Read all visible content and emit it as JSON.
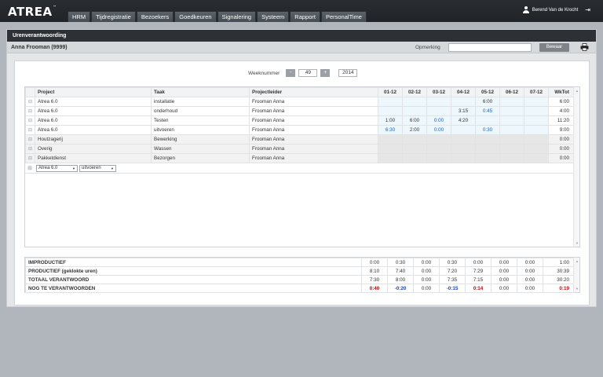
{
  "app": {
    "logo": "ATREA",
    "logo_tm": "™"
  },
  "nav": [
    "HRM",
    "Tijdregistratie",
    "Bezoekers",
    "Goedkeuren",
    "Signalering",
    "Systeem",
    "Rapport",
    "PersonalTime"
  ],
  "user": {
    "name": "Berend Van de Krocht"
  },
  "panel": {
    "title": "Urenverantwoording",
    "employee": "Anna Frooman (9999)",
    "remark_label": "Opmerking",
    "remark_value": "",
    "save_label": "Bewaar"
  },
  "week": {
    "label": "Weeknummer",
    "minus": "-",
    "plus": "+",
    "number": "49",
    "year": "2014"
  },
  "grid": {
    "headers": {
      "project": "Project",
      "task": "Taak",
      "leader": "Projectleider",
      "days": [
        "01-12",
        "02-12",
        "03-12",
        "04-12",
        "05-12",
        "06-12",
        "07-12"
      ],
      "total": "WkTot"
    },
    "rows": [
      {
        "expander": "⊟",
        "project": "Atrea 6.0",
        "task": "installatie",
        "leader": "Frooman Anna",
        "days": [
          "",
          "",
          "",
          "",
          "6:00",
          "",
          ""
        ],
        "total": "6:00"
      },
      {
        "expander": "⊟",
        "project": "Atrea 6.0",
        "task": "onderhoud",
        "leader": "Frooman Anna",
        "days": [
          "",
          "",
          "",
          "3:15",
          "0:45",
          "",
          ""
        ],
        "total": "4:00"
      },
      {
        "expander": "⊟",
        "project": "Atrea 6.0",
        "task": "Testen",
        "leader": "Frooman Anna",
        "days": [
          "1:00",
          "6:00",
          "0:00",
          "4:20",
          "",
          "",
          ""
        ],
        "total": "11:20"
      },
      {
        "expander": "⊟",
        "project": "Atrea 6.0",
        "task": "uitvoeren",
        "leader": "Frooman Anna",
        "days": [
          "6:30",
          "2:00",
          "0:00",
          "",
          "0:30",
          "",
          ""
        ],
        "total": "9:00"
      },
      {
        "expander": "⊟",
        "project": "Houtzagerij",
        "task": "Bewerking",
        "leader": "Frooman Anna",
        "days": [
          "",
          "",
          "",
          "",
          "",
          "",
          ""
        ],
        "total": "0:00"
      },
      {
        "expander": "⊟",
        "project": "Overig",
        "task": "Wassen",
        "leader": "Frooman Anna",
        "days": [
          "",
          "",
          "",
          "",
          "",
          "",
          ""
        ],
        "total": "0:00"
      },
      {
        "expander": "⊟",
        "project": "Pakketdienst",
        "task": "Bezorgen",
        "leader": "Frooman Anna",
        "days": [
          "",
          "",
          "",
          "",
          "",
          "",
          ""
        ],
        "total": "0:00"
      }
    ],
    "new_row": {
      "expander": "⊞",
      "project": "Atrea 6.0",
      "task": "uitvoeren"
    }
  },
  "summary": [
    {
      "label": "IMPRODUCTIEF",
      "days": [
        "0:00",
        "0:30",
        "0:00",
        "0:30",
        "0:00",
        "0:00",
        "0:00"
      ],
      "total": "1:00"
    },
    {
      "label": "PRODUCTIEF (geklokte uren)",
      "days": [
        "8:10",
        "7:40",
        "0:00",
        "7:20",
        "7:29",
        "0:00",
        "0:00"
      ],
      "total": "30:39"
    },
    {
      "label": "TOTAAL VERANTWOORD",
      "days": [
        "7:30",
        "8:00",
        "0:00",
        "7:35",
        "7:15",
        "0:00",
        "0:00"
      ],
      "total": "30:20"
    },
    {
      "label": "NOG TE VERANTWOORDEN",
      "days": [
        "0:40",
        "-0:20",
        "0:00",
        "-0:15",
        "0:14",
        "0:00",
        "0:00"
      ],
      "total": "0:19"
    }
  ],
  "colors": {
    "accent_blue": "#1a5fd0",
    "negative_red": "#cc0000",
    "header_dark": "#2d3136"
  }
}
